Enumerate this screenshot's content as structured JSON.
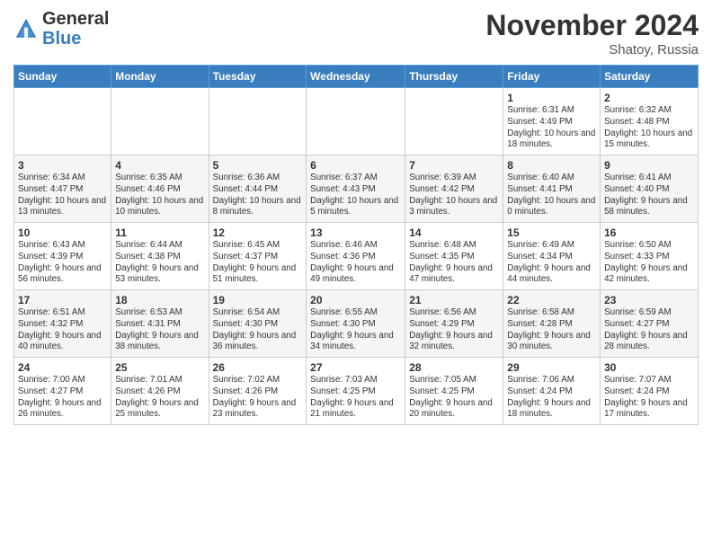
{
  "header": {
    "logo_general": "General",
    "logo_blue": "Blue",
    "month_title": "November 2024",
    "subtitle": "Shatoy, Russia"
  },
  "weekdays": [
    "Sunday",
    "Monday",
    "Tuesday",
    "Wednesday",
    "Thursday",
    "Friday",
    "Saturday"
  ],
  "weeks": [
    [
      {
        "day": "",
        "info": ""
      },
      {
        "day": "",
        "info": ""
      },
      {
        "day": "",
        "info": ""
      },
      {
        "day": "",
        "info": ""
      },
      {
        "day": "",
        "info": ""
      },
      {
        "day": "1",
        "info": "Sunrise: 6:31 AM\nSunset: 4:49 PM\nDaylight: 10 hours and 18 minutes."
      },
      {
        "day": "2",
        "info": "Sunrise: 6:32 AM\nSunset: 4:48 PM\nDaylight: 10 hours and 15 minutes."
      }
    ],
    [
      {
        "day": "3",
        "info": "Sunrise: 6:34 AM\nSunset: 4:47 PM\nDaylight: 10 hours and 13 minutes."
      },
      {
        "day": "4",
        "info": "Sunrise: 6:35 AM\nSunset: 4:46 PM\nDaylight: 10 hours and 10 minutes."
      },
      {
        "day": "5",
        "info": "Sunrise: 6:36 AM\nSunset: 4:44 PM\nDaylight: 10 hours and 8 minutes."
      },
      {
        "day": "6",
        "info": "Sunrise: 6:37 AM\nSunset: 4:43 PM\nDaylight: 10 hours and 5 minutes."
      },
      {
        "day": "7",
        "info": "Sunrise: 6:39 AM\nSunset: 4:42 PM\nDaylight: 10 hours and 3 minutes."
      },
      {
        "day": "8",
        "info": "Sunrise: 6:40 AM\nSunset: 4:41 PM\nDaylight: 10 hours and 0 minutes."
      },
      {
        "day": "9",
        "info": "Sunrise: 6:41 AM\nSunset: 4:40 PM\nDaylight: 9 hours and 58 minutes."
      }
    ],
    [
      {
        "day": "10",
        "info": "Sunrise: 6:43 AM\nSunset: 4:39 PM\nDaylight: 9 hours and 56 minutes."
      },
      {
        "day": "11",
        "info": "Sunrise: 6:44 AM\nSunset: 4:38 PM\nDaylight: 9 hours and 53 minutes."
      },
      {
        "day": "12",
        "info": "Sunrise: 6:45 AM\nSunset: 4:37 PM\nDaylight: 9 hours and 51 minutes."
      },
      {
        "day": "13",
        "info": "Sunrise: 6:46 AM\nSunset: 4:36 PM\nDaylight: 9 hours and 49 minutes."
      },
      {
        "day": "14",
        "info": "Sunrise: 6:48 AM\nSunset: 4:35 PM\nDaylight: 9 hours and 47 minutes."
      },
      {
        "day": "15",
        "info": "Sunrise: 6:49 AM\nSunset: 4:34 PM\nDaylight: 9 hours and 44 minutes."
      },
      {
        "day": "16",
        "info": "Sunrise: 6:50 AM\nSunset: 4:33 PM\nDaylight: 9 hours and 42 minutes."
      }
    ],
    [
      {
        "day": "17",
        "info": "Sunrise: 6:51 AM\nSunset: 4:32 PM\nDaylight: 9 hours and 40 minutes."
      },
      {
        "day": "18",
        "info": "Sunrise: 6:53 AM\nSunset: 4:31 PM\nDaylight: 9 hours and 38 minutes."
      },
      {
        "day": "19",
        "info": "Sunrise: 6:54 AM\nSunset: 4:30 PM\nDaylight: 9 hours and 36 minutes."
      },
      {
        "day": "20",
        "info": "Sunrise: 6:55 AM\nSunset: 4:30 PM\nDaylight: 9 hours and 34 minutes."
      },
      {
        "day": "21",
        "info": "Sunrise: 6:56 AM\nSunset: 4:29 PM\nDaylight: 9 hours and 32 minutes."
      },
      {
        "day": "22",
        "info": "Sunrise: 6:58 AM\nSunset: 4:28 PM\nDaylight: 9 hours and 30 minutes."
      },
      {
        "day": "23",
        "info": "Sunrise: 6:59 AM\nSunset: 4:27 PM\nDaylight: 9 hours and 28 minutes."
      }
    ],
    [
      {
        "day": "24",
        "info": "Sunrise: 7:00 AM\nSunset: 4:27 PM\nDaylight: 9 hours and 26 minutes."
      },
      {
        "day": "25",
        "info": "Sunrise: 7:01 AM\nSunset: 4:26 PM\nDaylight: 9 hours and 25 minutes."
      },
      {
        "day": "26",
        "info": "Sunrise: 7:02 AM\nSunset: 4:26 PM\nDaylight: 9 hours and 23 minutes."
      },
      {
        "day": "27",
        "info": "Sunrise: 7:03 AM\nSunset: 4:25 PM\nDaylight: 9 hours and 21 minutes."
      },
      {
        "day": "28",
        "info": "Sunrise: 7:05 AM\nSunset: 4:25 PM\nDaylight: 9 hours and 20 minutes."
      },
      {
        "day": "29",
        "info": "Sunrise: 7:06 AM\nSunset: 4:24 PM\nDaylight: 9 hours and 18 minutes."
      },
      {
        "day": "30",
        "info": "Sunrise: 7:07 AM\nSunset: 4:24 PM\nDaylight: 9 hours and 17 minutes."
      }
    ]
  ]
}
